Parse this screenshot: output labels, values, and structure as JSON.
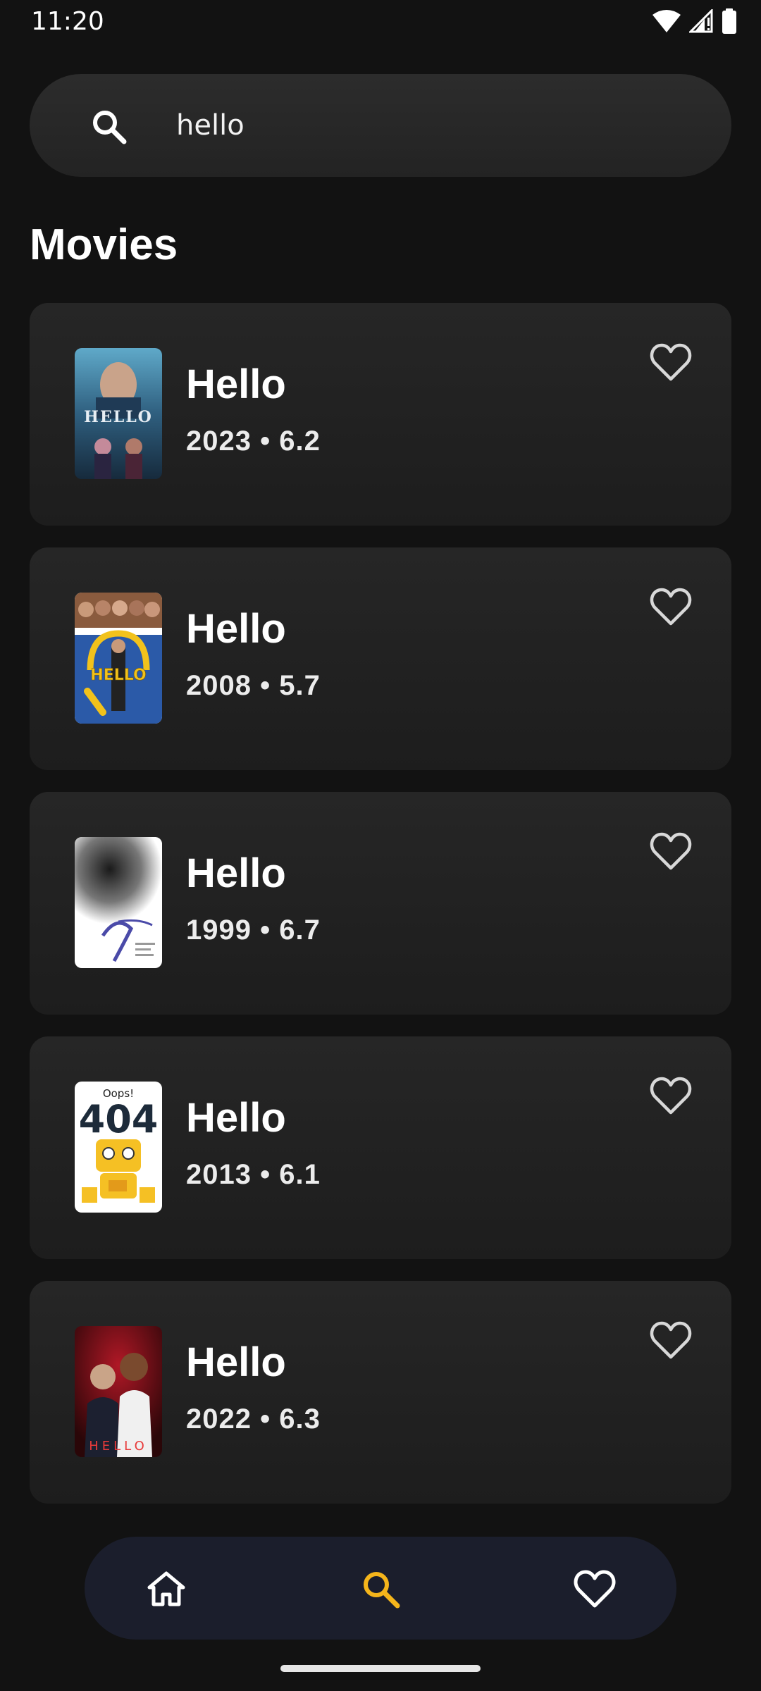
{
  "status_bar": {
    "time": "11:20"
  },
  "search": {
    "value": "hello",
    "icon": "search-icon"
  },
  "section": {
    "title": "Movies"
  },
  "movies": [
    {
      "title": "Hello",
      "meta": "2023 • 6.2",
      "poster": "hello-2023-poster"
    },
    {
      "title": "Hello",
      "meta": "2008 • 5.7",
      "poster": "hello-2008-poster"
    },
    {
      "title": "Hello",
      "meta": "1999 • 6.7",
      "poster": "hello-1999-poster"
    },
    {
      "title": "Hello",
      "meta": "2013 • 6.1",
      "poster": "hello-2013-poster"
    },
    {
      "title": "Hello",
      "meta": "2022 • 6.3",
      "poster": "hello-2022-poster"
    }
  ],
  "bottom_nav": {
    "items": [
      {
        "icon": "home-icon",
        "active": false
      },
      {
        "icon": "search-icon",
        "active": true
      },
      {
        "icon": "heart-icon",
        "active": false
      }
    ],
    "active_color": "#f5b51b",
    "inactive_color": "#ffffff"
  },
  "poster_text": {
    "p1": "HELLO",
    "p2": "HELLO",
    "p4_top": "Oops!",
    "p4_big": "404",
    "p5": "HELLO"
  }
}
